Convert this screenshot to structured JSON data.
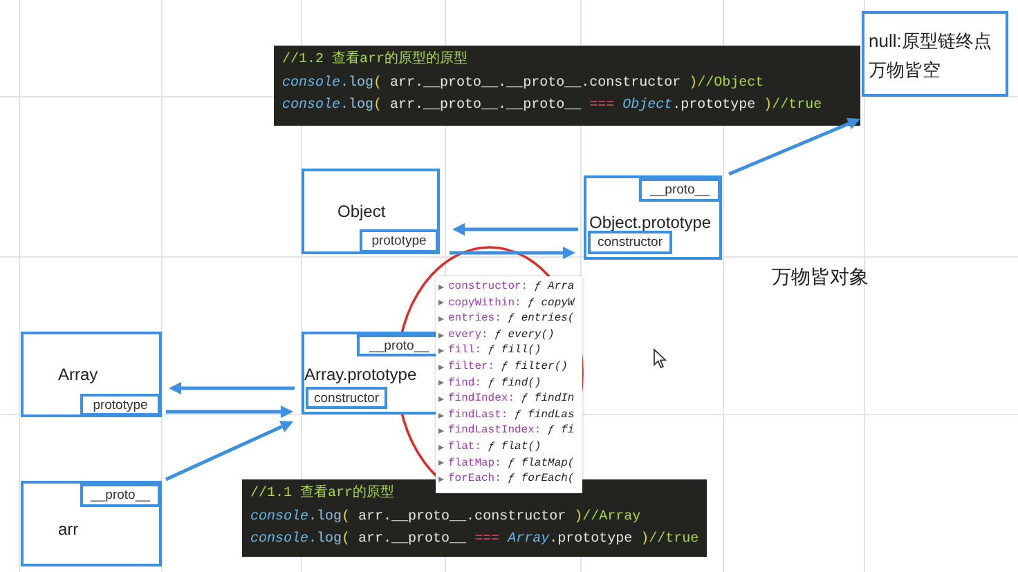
{
  "top_code": {
    "lines": [
      {
        "tokens": [
          {
            "kind": "comment",
            "text": "//1.2 查看arr的原型的原型"
          }
        ]
      },
      {
        "tokens": [
          {
            "kind": "obj",
            "text": "console"
          },
          {
            "kind": "fn",
            "text": ".log"
          },
          {
            "kind": "paren",
            "text": "("
          },
          {
            "kind": "plain",
            "text": " arr.__proto__.__proto__.constructor "
          },
          {
            "kind": "paren",
            "text": ")"
          },
          {
            "kind": "comment",
            "text": "//Object"
          }
        ]
      },
      {
        "tokens": [
          {
            "kind": "obj",
            "text": "console"
          },
          {
            "kind": "fn",
            "text": ".log"
          },
          {
            "kind": "paren",
            "text": "("
          },
          {
            "kind": "plain",
            "text": " arr.__proto__.__proto__ "
          },
          {
            "kind": "op",
            "text": "==="
          },
          {
            "kind": "obj",
            "text": " Object"
          },
          {
            "kind": "plain",
            "text": ".prototype "
          },
          {
            "kind": "paren",
            "text": ")"
          },
          {
            "kind": "comment",
            "text": "//true"
          }
        ]
      }
    ]
  },
  "nodes": [
    {
      "lines": [
        "null:原型链终点",
        "万物皆空"
      ]
    },
    {
      "lines": [
        "Object"
      ],
      "slots": [
        "prototype"
      ]
    },
    {
      "lines": [
        "Object.prototype"
      ],
      "slots": [
        "__proto__",
        "constructor"
      ]
    },
    {
      "lines": [
        "Array"
      ],
      "slots": [
        "prototype"
      ]
    },
    {
      "lines": [
        "Array.prototype"
      ],
      "slots": [
        "__proto__",
        "constructor"
      ]
    },
    {
      "lines": [
        "arr"
      ],
      "slots": [
        "__proto__"
      ]
    }
  ],
  "caption": "万物皆对象",
  "devtools_list": [
    {
      "name": "constructor:",
      "value": "ƒ Arra"
    },
    {
      "name": "copyWithin:",
      "value": "ƒ copyW"
    },
    {
      "name": "entries:",
      "value": "ƒ entries("
    },
    {
      "name": "every:",
      "value": "ƒ every()"
    },
    {
      "name": "fill:",
      "value": "ƒ fill()"
    },
    {
      "name": "filter:",
      "value": "ƒ filter()"
    },
    {
      "name": "find:",
      "value": "ƒ find()"
    },
    {
      "name": "findIndex:",
      "value": "ƒ findIn"
    },
    {
      "name": "findLast:",
      "value": "ƒ findLas"
    },
    {
      "name": "findLastIndex:",
      "value": "ƒ fi"
    },
    {
      "name": "flat:",
      "value": "ƒ flat()"
    },
    {
      "name": "flatMap:",
      "value": "ƒ flatMap("
    },
    {
      "name": "forEach:",
      "value": "ƒ forEach("
    }
  ],
  "bottom_code": {
    "lines": [
      {
        "tokens": [
          {
            "kind": "comment",
            "text": "//1.1 查看arr的原型"
          }
        ]
      },
      {
        "tokens": [
          {
            "kind": "obj",
            "text": "console"
          },
          {
            "kind": "fn",
            "text": ".log"
          },
          {
            "kind": "paren",
            "text": "("
          },
          {
            "kind": "plain",
            "text": " arr.__proto__.constructor "
          },
          {
            "kind": "paren",
            "text": ")"
          },
          {
            "kind": "comment",
            "text": "//Array"
          }
        ]
      },
      {
        "tokens": [
          {
            "kind": "obj",
            "text": "console"
          },
          {
            "kind": "fn",
            "text": ".log"
          },
          {
            "kind": "paren",
            "text": "("
          },
          {
            "kind": "plain",
            "text": " arr.__proto__ "
          },
          {
            "kind": "op",
            "text": "==="
          },
          {
            "kind": "obj",
            "text": " Array"
          },
          {
            "kind": "plain",
            "text": ".prototype "
          },
          {
            "kind": "paren",
            "text": ")"
          },
          {
            "kind": "comment",
            "text": "//true"
          }
        ]
      }
    ]
  }
}
